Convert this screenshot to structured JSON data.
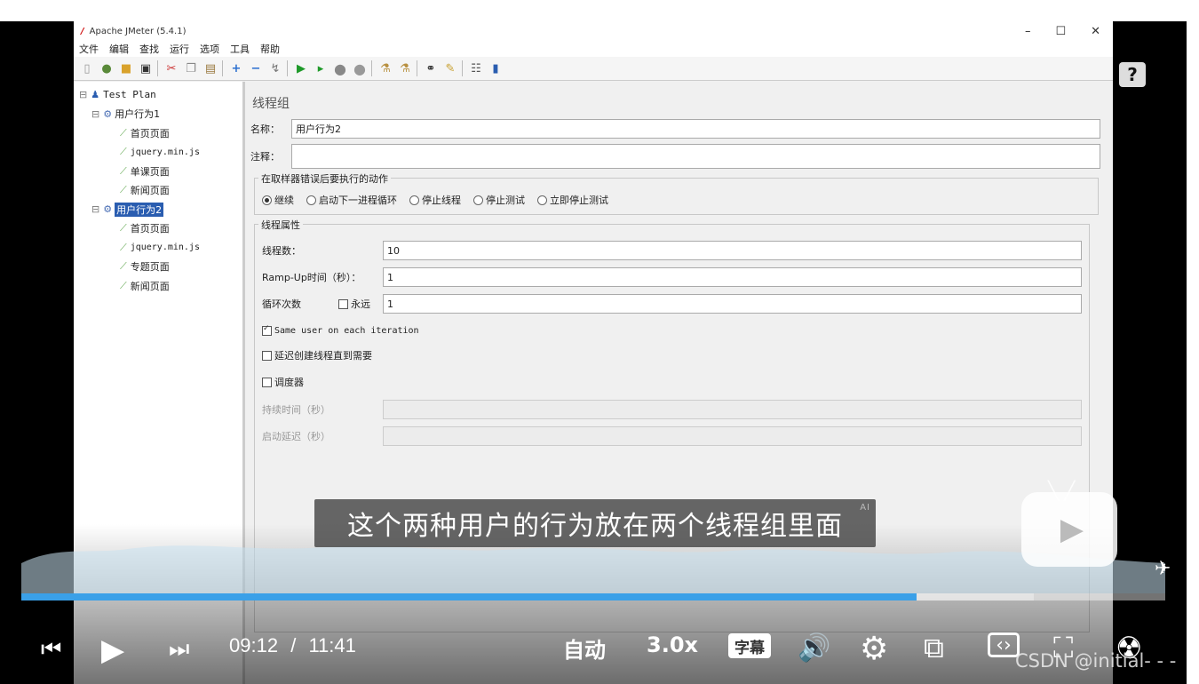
{
  "jmeter": {
    "title": "Apache JMeter (5.4.1)",
    "window_buttons": [
      "–",
      "☐",
      "✕"
    ],
    "menu": [
      "文件",
      "编辑",
      "查找",
      "运行",
      "选项",
      "工具",
      "帮助"
    ],
    "toolbar_icons": [
      "new-icon",
      "templates-icon",
      "open-icon",
      "save-icon",
      "cut-icon",
      "copy-icon",
      "paste-icon",
      "expand-icon",
      "collapse-icon",
      "toggle-icon",
      "start-icon",
      "start-no-pause-icon",
      "stop-icon",
      "shutdown-icon",
      "clear-icon",
      "clear-all-icon",
      "search-icon",
      "reset-search-icon",
      "function-helper-icon",
      "help-icon"
    ],
    "tree": {
      "root": "Test Plan",
      "groups": [
        {
          "label": "用户行为1",
          "children": [
            "首页页面",
            "jquery.min.js",
            "单课页面",
            "新闻页面"
          ]
        },
        {
          "label": "用户行为2",
          "children": [
            "首页页面",
            "jquery.min.js",
            "专题页面",
            "新闻页面"
          ]
        }
      ]
    },
    "panel": {
      "title": "线程组",
      "name_label": "名称：",
      "name_value": "用户行为2",
      "comment_label": "注释：",
      "comment_value": "",
      "error_group_title": "在取样器错误后要执行的动作",
      "error_options": [
        "继续",
        "启动下一进程循环",
        "停止线程",
        "停止测试",
        "立即停止测试"
      ],
      "error_selected": "继续",
      "props_title": "线程属性",
      "threads_label": "线程数：",
      "threads_value": "10",
      "rampup_label": "Ramp-Up时间（秒）：",
      "rampup_value": "1",
      "loop_label": "循环次数",
      "forever_label": "永远",
      "loop_value": "1",
      "same_user_label": "Same user on each iteration",
      "delay_label": "延迟创建线程直到需要",
      "scheduler_label": "调度器",
      "duration_label": "持续时间（秒）",
      "startup_delay_label": "启动延迟（秒）"
    }
  },
  "player": {
    "subtitle": "这个两种用户的行为放在两个线程组里面",
    "subtitle_badge": "AI",
    "help_glyph": "?",
    "current_time": "09:12",
    "separator": "/",
    "total_time": "11:41",
    "progress_fraction": 0.7823,
    "buffer_fraction": 0.885,
    "quality_label": "自动",
    "speed_label": "3.0x",
    "caption_label": "字幕",
    "accent_color": "#3aa0e8"
  },
  "watermark": "CSDN @initial- - -"
}
